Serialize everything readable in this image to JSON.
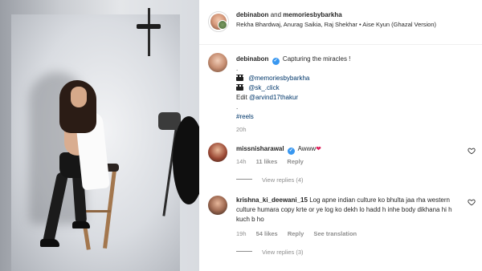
{
  "header": {
    "user1": "debinabon",
    "joiner": "and",
    "user2": "memoriesbybarkha",
    "music": "Rekha Bhardwaj, Anurag Saikia, Raj Shekhar • Aise Kyun (Ghazal Version)"
  },
  "caption": {
    "username": "debinabon",
    "verified_glyph": "✓",
    "text": "Capturing the miracles !",
    "dot1": ".",
    "credit1": "@memoriesbybarkha",
    "credit2": "@sk_.click",
    "edit_prefix": "Edit",
    "edit_credit": "@arvind17thakur",
    "dot2": ".",
    "hashtag": "#reels",
    "time": "20h"
  },
  "comments": [
    {
      "username": "missnisharawal",
      "verified_glyph": "✓",
      "text": "Awww",
      "emoji": "❤",
      "time": "14h",
      "likes": "11 likes",
      "reply": "Reply",
      "view_replies": "View replies (4)"
    },
    {
      "username": "krishna_ki_deewani_15",
      "text": "Log apne indian culture ko bhulta jaa rha western culture humara copy krte or ye log ko dekh lo hadd h inhe body dikhana hi h kuch b ho",
      "time": "19h",
      "likes": "54 likes",
      "reply": "Reply",
      "see_translation": "See translation",
      "view_replies": "View replies (3)"
    }
  ],
  "colors": {
    "verified": "#3897f0",
    "link": "#00376b",
    "muted": "#8e8e8e",
    "heart": "#e0245e"
  },
  "icons": [
    "clapperboard-icon",
    "verified-badge-icon",
    "heart-outline-icon"
  ]
}
